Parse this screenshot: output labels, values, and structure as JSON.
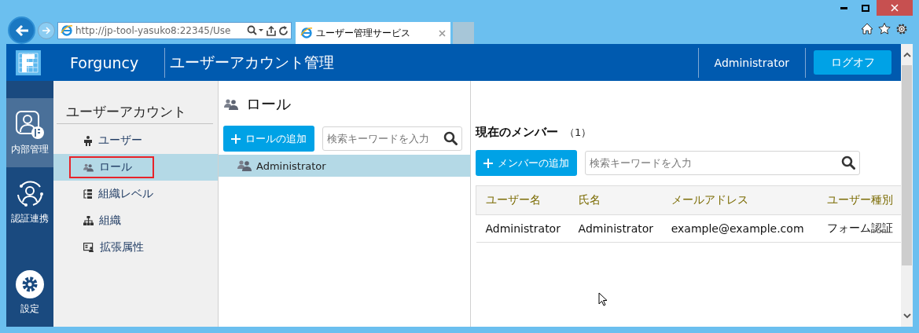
{
  "browser": {
    "address": "http://jp-tool-yasuko8:22345/Use",
    "tab_title": "ユーザー管理サービス"
  },
  "header": {
    "brand": "Forguncy",
    "title": "ユーザーアカウント管理",
    "user": "Administrator",
    "logoff": "ログオフ"
  },
  "nav": [
    {
      "label": "内部管理",
      "selected": true
    },
    {
      "label": "認証連携",
      "selected": false
    },
    {
      "label": "設定",
      "selected": false
    }
  ],
  "sidebar": {
    "heading": "ユーザーアカウント",
    "items": [
      {
        "label": "ユーザー",
        "selected": false,
        "outlined": false
      },
      {
        "label": "ロール",
        "selected": true,
        "outlined": true
      },
      {
        "label": "組織レベル",
        "selected": false,
        "outlined": false
      },
      {
        "label": "組織",
        "selected": false,
        "outlined": false
      },
      {
        "label": "拡張属性",
        "selected": false,
        "outlined": false
      }
    ]
  },
  "roles": {
    "title": "ロール",
    "add_button": "ロールの追加",
    "search_placeholder": "検索キーワードを入力",
    "items": [
      {
        "label": "Administrator",
        "selected": true
      }
    ]
  },
  "members": {
    "title": "現在のメンバー",
    "count": "（1）",
    "add_button": "メンバーの追加",
    "search_placeholder": "検索キーワードを入力",
    "columns": [
      "ユーザー名",
      "氏名",
      "メールアドレス",
      "ユーザー種別"
    ],
    "rows": [
      [
        "Administrator",
        "Administrator",
        "example@example.com",
        "フォーム認証"
      ]
    ]
  }
}
